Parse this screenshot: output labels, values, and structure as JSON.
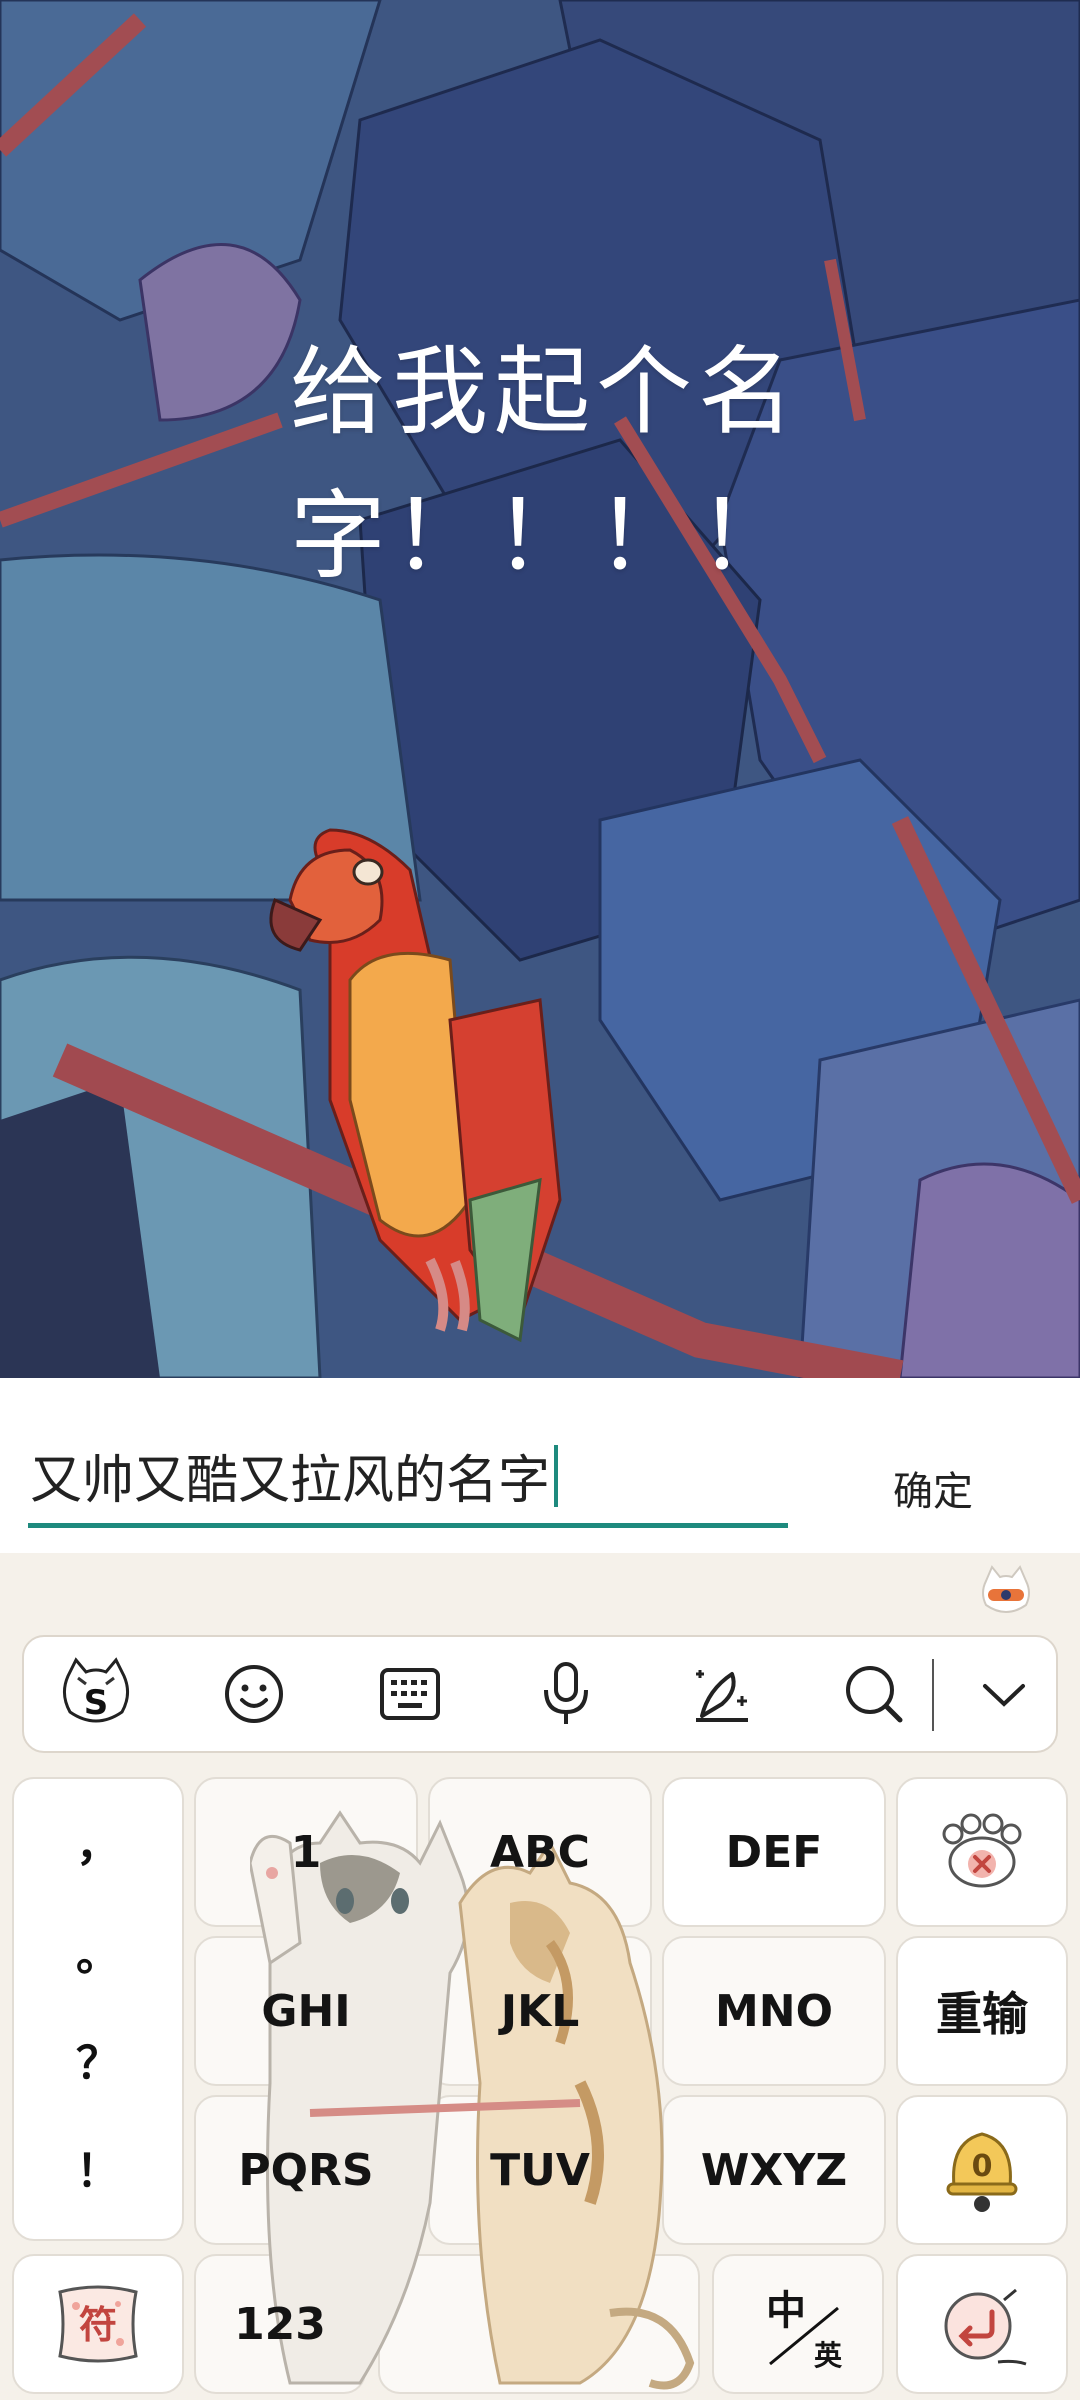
{
  "prompt": {
    "line1": "给我起个名",
    "line2": "字！！！！"
  },
  "input": {
    "value": "又帅又酷又拉风的名字"
  },
  "confirm_label": "确定",
  "toolbar": {
    "items": [
      "sogou-logo-icon",
      "emoji-icon",
      "keyboard-icon",
      "microphone-icon",
      "handwriting-icon",
      "search-icon",
      "collapse-chevron-icon"
    ]
  },
  "keyboard": {
    "punctuation": [
      "，",
      "。",
      "？",
      "！"
    ],
    "keys": {
      "k1": "1",
      "abc": "ABC",
      "def": "DEF",
      "ghi": "GHI",
      "jkl": "JKL",
      "mno": "MNO",
      "pqrs": "PQRS",
      "tuv": "TUV",
      "wxyz": "WXYZ",
      "reenter": "重输",
      "num": "123",
      "symbols": "符",
      "lang_main": "中",
      "lang_sub": "英"
    }
  },
  "colors": {
    "accent": "#1e8a7e",
    "keyboard_bg": "#f5f1ea",
    "illustration_bg": "#3d5583"
  }
}
